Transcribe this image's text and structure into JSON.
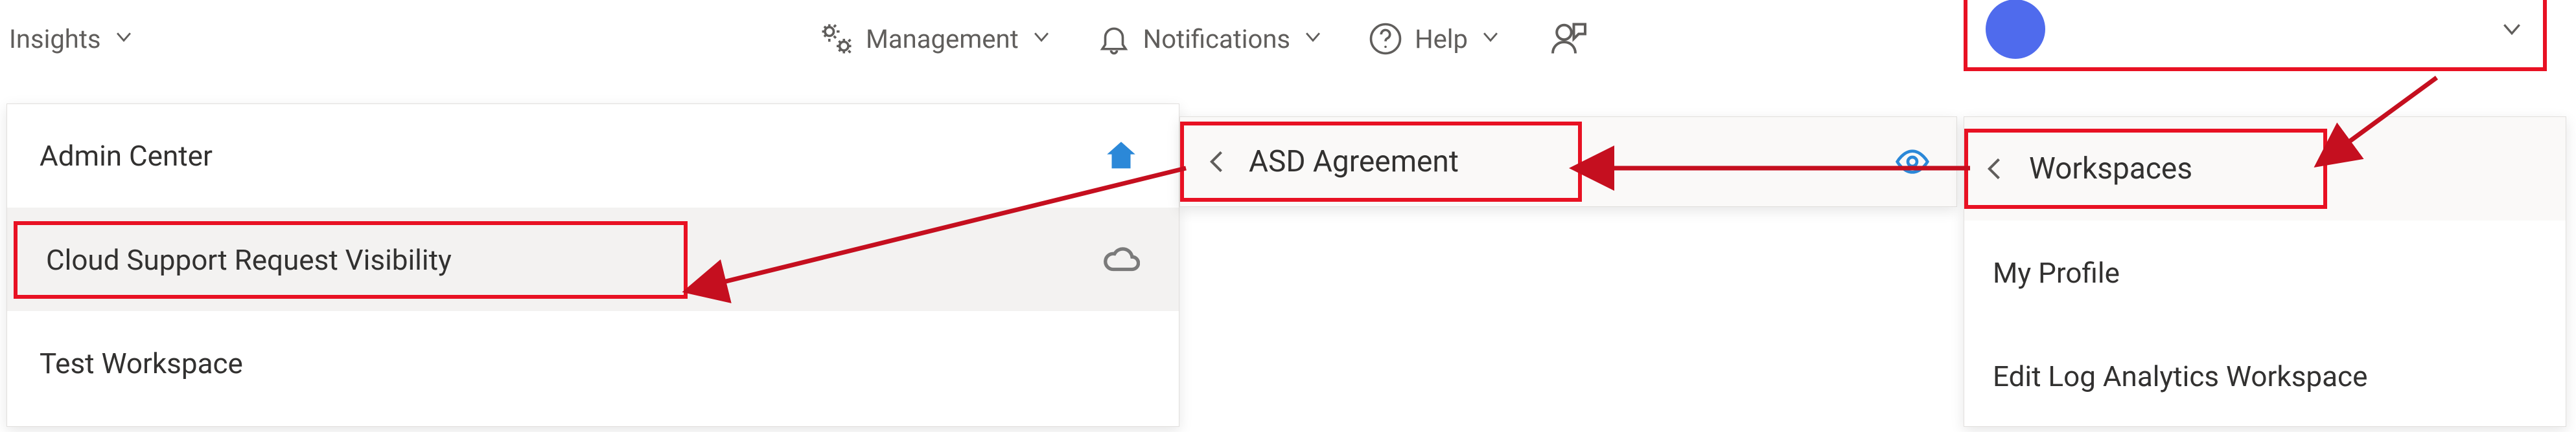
{
  "colors": {
    "highlight": "#e81123",
    "arrow": "#c50f1f",
    "avatar": "#4f6bed",
    "home_icon": "#2b88d8"
  },
  "topnav": {
    "insights_label": "Insights",
    "management_label": "Management",
    "notifications_label": "Notifications",
    "help_label": "Help"
  },
  "profile": {
    "display_name": ""
  },
  "left_panel": {
    "items": [
      {
        "label": "Admin Center",
        "icon": "home"
      },
      {
        "label": "Cloud Support Request Visibility",
        "icon": "cloud",
        "highlighted": true
      },
      {
        "label": "Test Workspace",
        "icon": ""
      }
    ]
  },
  "mid_panel": {
    "back_label": "ASD Agreement"
  },
  "right_panel": {
    "header_back_label": "Workspaces",
    "items": [
      {
        "label": "My Profile"
      },
      {
        "label": "Edit Log Analytics Workspace"
      }
    ]
  }
}
